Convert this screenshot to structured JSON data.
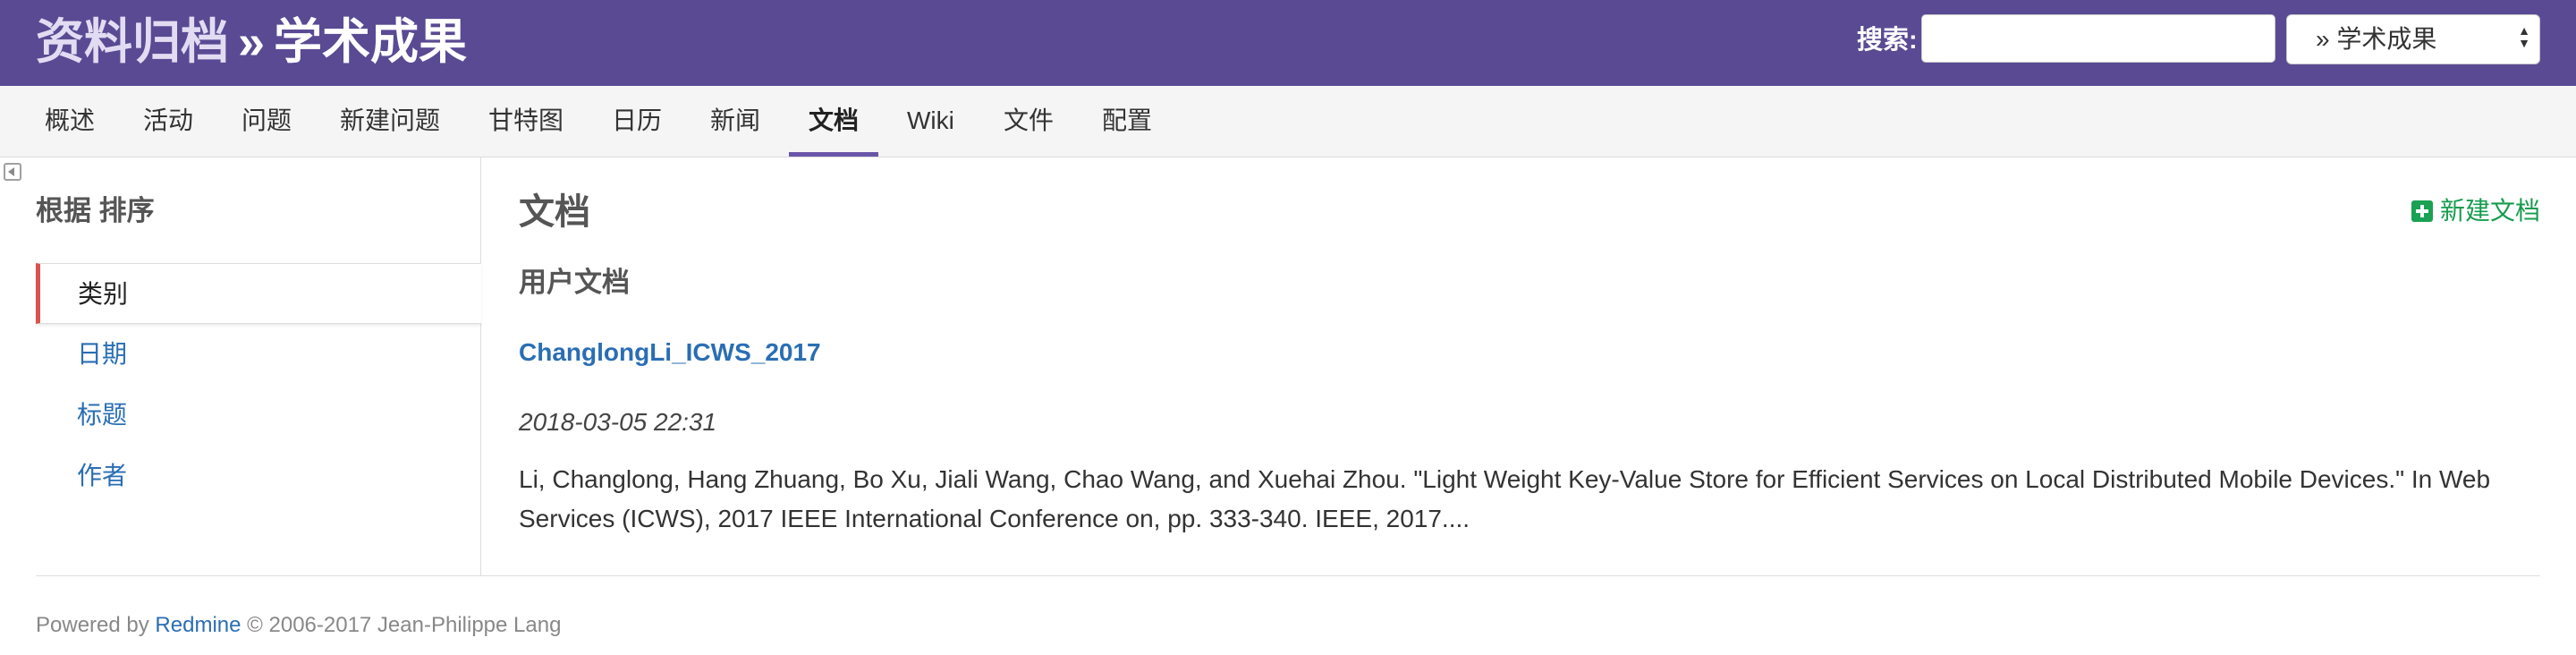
{
  "header": {
    "parent_project": "资料归档",
    "separator": "»",
    "current_project": "学术成果",
    "search_label": "搜索:",
    "search_value": "",
    "project_select": "» 学术成果"
  },
  "menu": {
    "items": [
      {
        "label": "概述"
      },
      {
        "label": "活动"
      },
      {
        "label": "问题"
      },
      {
        "label": "新建问题"
      },
      {
        "label": "甘特图"
      },
      {
        "label": "日历"
      },
      {
        "label": "新闻"
      },
      {
        "label": "文档",
        "selected": true
      },
      {
        "label": "Wiki"
      },
      {
        "label": "文件"
      },
      {
        "label": "配置"
      }
    ]
  },
  "sidebar": {
    "title": "根据 排序",
    "items": [
      {
        "label": "类别",
        "selected": true
      },
      {
        "label": "日期"
      },
      {
        "label": "标题"
      },
      {
        "label": "作者"
      }
    ]
  },
  "content": {
    "title": "文档",
    "new_document": "新建文档",
    "category": "用户文档",
    "document": {
      "title": "ChanglongLi_ICWS_2017",
      "date": "2018-03-05 22:31",
      "description": "Li, Changlong, Hang Zhuang, Bo Xu, Jiali Wang, Chao Wang, and Xuehai Zhou. \"Light Weight Key-Value Store for Efficient Services on Local Distributed Mobile Devices.\" In Web Services (ICWS), 2017 IEEE International Conference on, pp. 333-340. IEEE, 2017...."
    }
  },
  "footer": {
    "powered_by": "Powered by",
    "link": "Redmine",
    "copyright": "© 2006-2017 Jean-Philippe Lang"
  },
  "colors": {
    "header_bg": "#5a4a93",
    "link": "#2a6eb4",
    "selected_tab_underline": "#6956a9",
    "selected_sidebar_marker": "#d9534f",
    "new_doc_green": "#169c4e"
  },
  "icons": {
    "sidebar_toggle": "collapse-sidebar-icon",
    "new_document": "plus-square-icon",
    "select_arrows": "select-arrows-icon"
  }
}
